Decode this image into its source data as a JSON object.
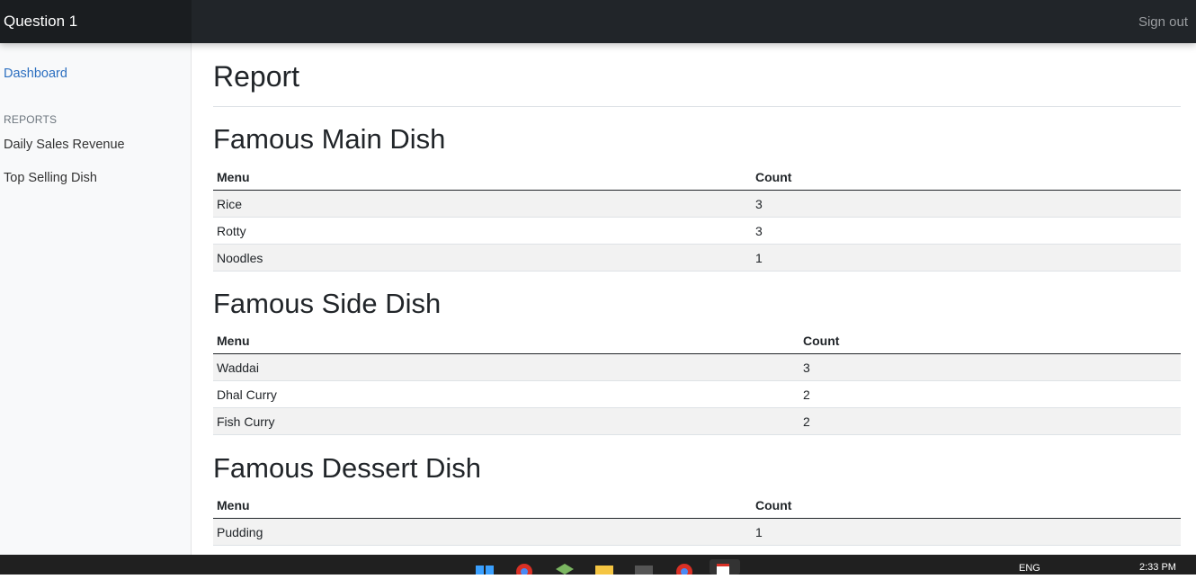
{
  "header": {
    "brand": "Question 1",
    "signout_label": "Sign out"
  },
  "sidebar": {
    "dashboard_label": "Dashboard",
    "reports_heading": "REPORTS",
    "items": [
      {
        "label": "Daily Sales Revenue"
      },
      {
        "label": "Top Selling Dish"
      }
    ]
  },
  "main": {
    "title": "Report",
    "sections": [
      {
        "title": "Famous Main Dish",
        "columns": [
          "Menu",
          "Count"
        ],
        "rows": [
          {
            "menu": "Rice",
            "count": "3"
          },
          {
            "menu": "Rotty",
            "count": "3"
          },
          {
            "menu": "Noodles",
            "count": "1"
          }
        ]
      },
      {
        "title": "Famous Side Dish",
        "columns": [
          "Menu",
          "Count"
        ],
        "rows": [
          {
            "menu": "Waddai",
            "count": "3"
          },
          {
            "menu": "Dhal Curry",
            "count": "2"
          },
          {
            "menu": "Fish Curry",
            "count": "2"
          }
        ]
      },
      {
        "title": "Famous Dessert Dish",
        "columns": [
          "Menu",
          "Count"
        ],
        "rows": [
          {
            "menu": "Pudding",
            "count": "1"
          }
        ]
      }
    ]
  },
  "taskbar": {
    "language": "ENG",
    "time": "2:33 PM",
    "icons": [
      "start-icon",
      "chrome-icon",
      "app-icon",
      "file-explorer-icon",
      "terminal-icon",
      "chrome-icon",
      "calendar-app-icon"
    ]
  }
}
